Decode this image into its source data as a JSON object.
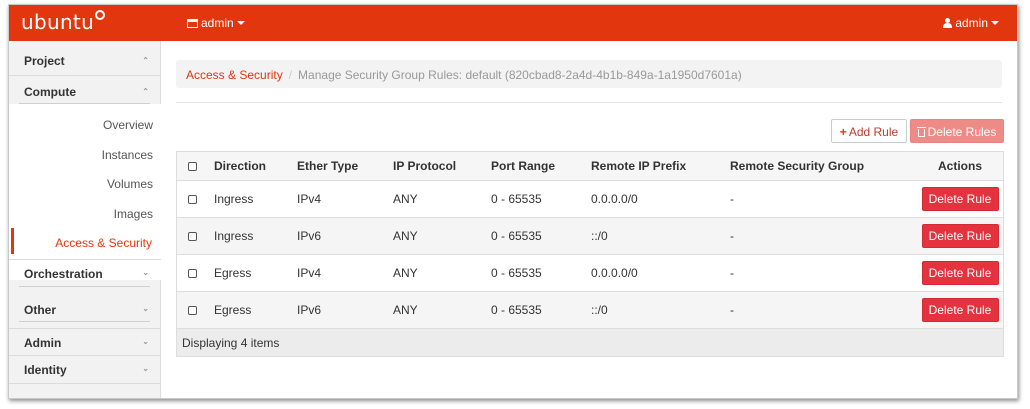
{
  "topbar": {
    "logo": "ubuntu",
    "project": "admin",
    "user": "admin",
    "color": "#e2360f"
  },
  "sidebar": {
    "project_label": "Project",
    "compute_label": "Compute",
    "compute_items": [
      "Overview",
      "Instances",
      "Volumes",
      "Images",
      "Access & Security"
    ],
    "active_item": "Access & Security",
    "orchestration_label": "Orchestration",
    "other_label": "Other",
    "admin_label": "Admin",
    "identity_label": "Identity"
  },
  "breadcrumb": {
    "parent": "Access & Security",
    "current": "Manage Security Group Rules: default (820cbad8-2a4d-4b1b-849a-1a1950d7601a)"
  },
  "actions": {
    "add_rule": "Add Rule",
    "delete_rules": "Delete Rules"
  },
  "table": {
    "columns": [
      "Direction",
      "Ether Type",
      "IP Protocol",
      "Port Range",
      "Remote IP Prefix",
      "Remote Security Group",
      "Actions"
    ],
    "rows": [
      {
        "direction": "Ingress",
        "ether_type": "IPv4",
        "ip_protocol": "ANY",
        "port_range": "0 - 65535",
        "remote_ip_prefix": "0.0.0.0/0",
        "remote_security_group": "-",
        "action": "Delete Rule"
      },
      {
        "direction": "Ingress",
        "ether_type": "IPv6",
        "ip_protocol": "ANY",
        "port_range": "0 - 65535",
        "remote_ip_prefix": "::/0",
        "remote_security_group": "-",
        "action": "Delete Rule"
      },
      {
        "direction": "Egress",
        "ether_type": "IPv4",
        "ip_protocol": "ANY",
        "port_range": "0 - 65535",
        "remote_ip_prefix": "0.0.0.0/0",
        "remote_security_group": "-",
        "action": "Delete Rule"
      },
      {
        "direction": "Egress",
        "ether_type": "IPv6",
        "ip_protocol": "ANY",
        "port_range": "0 - 65535",
        "remote_ip_prefix": "::/0",
        "remote_security_group": "-",
        "action": "Delete Rule"
      }
    ],
    "footer": "Displaying 4 items"
  }
}
